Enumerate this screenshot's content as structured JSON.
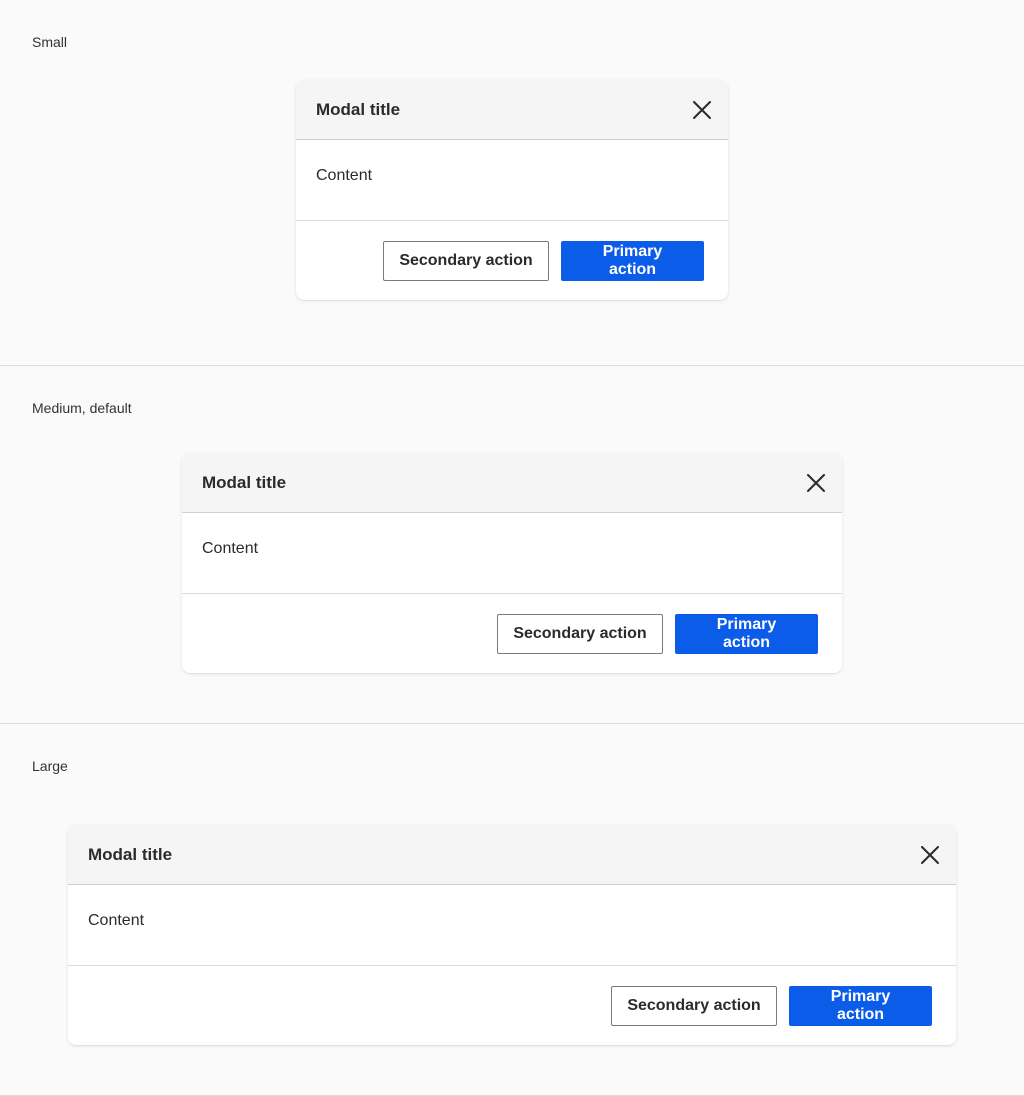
{
  "sections": [
    {
      "label": "Small",
      "modal": {
        "title": "Modal title",
        "content": "Content",
        "secondary_label": "Secondary action",
        "primary_label": "Primary action"
      }
    },
    {
      "label": "Medium, default",
      "modal": {
        "title": "Modal title",
        "content": "Content",
        "secondary_label": "Secondary action",
        "primary_label": "Primary action"
      }
    },
    {
      "label": "Large",
      "modal": {
        "title": "Modal title",
        "content": "Content",
        "secondary_label": "Secondary action",
        "primary_label": "Primary action"
      }
    }
  ],
  "icons": {
    "close": "close-icon"
  },
  "colors": {
    "primary": "#0b5ce8",
    "background": "#fafafa",
    "header_bg": "#f5f5f5"
  }
}
